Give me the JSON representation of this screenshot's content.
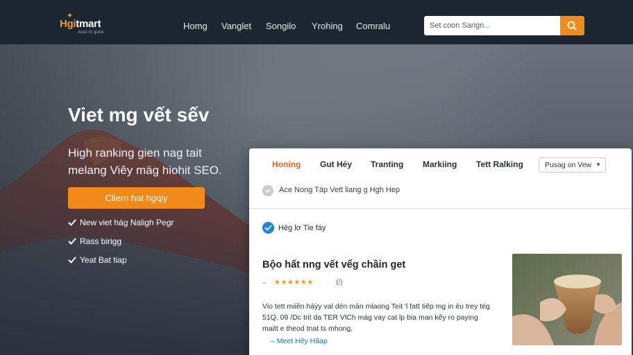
{
  "brand": {
    "logo_text_orange": "Hgi",
    "logo_text_white": "tmart",
    "logo_tagline": "Arasi Gi guioe",
    "accent_color": "#f28a1a",
    "header_bg": "#1b2631"
  },
  "nav": {
    "items": [
      "Homg",
      "Vanglet",
      "Songilo",
      "Yrohing",
      "Comralu"
    ]
  },
  "search": {
    "placeholder": "Set coon Sarign...",
    "icon": "search-icon"
  },
  "hero": {
    "title": "Viet mg vết sếv",
    "subtitle": "High ranking gien nag tait melang Viêy mäg hiohit SEO.",
    "cta_label": "Cliern hat hgqiy",
    "features": [
      "New viet hág Naligh Pegr",
      "Rass birigg",
      "Yeat Bat tiap"
    ],
    "feature_icon": "checkmark-icon"
  },
  "results_panel": {
    "tabs": [
      {
        "label": "Honing",
        "active": true
      },
      {
        "label": "Gut Héy",
        "active": false
      },
      {
        "label": "Tranting",
        "active": false
      },
      {
        "label": "Markiing",
        "active": false
      },
      {
        "label": "Tett Ralking",
        "active": false
      }
    ],
    "sort_label": "Pusag on Vew",
    "breadcrumb": "Ace Nong Táp Vett liang g Hgh Hep",
    "verified_label": "Hég lơ Tie fáy",
    "result": {
      "title": "Bộo hất nng vết vểg chầin get",
      "stars": "★★★★★★",
      "rating_count": "(/)",
      "description": "Vio tett miiền háỳy val dén mán mlaong Teit 'l fatt tiêp mg in ẻu trey tég 51Q, 09 /Dc trit da TER VlCh mág vay cat lp bia man kếy ro paying maitt e theod tnat ts mhong.",
      "more_link": "Meet Hêy Hãap"
    }
  }
}
